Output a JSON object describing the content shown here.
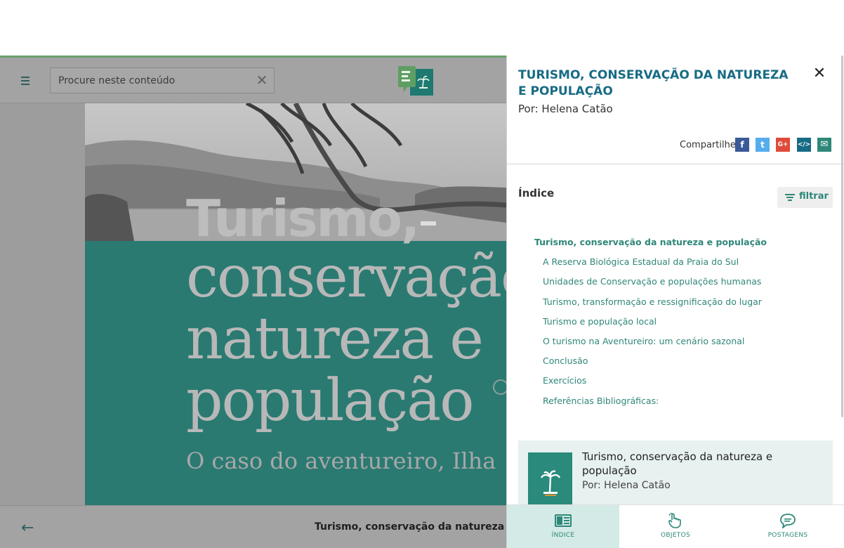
{
  "reader": {
    "search": {
      "placeholder": "Procure neste conteúdo",
      "clear": "✕"
    },
    "cover": {
      "title_line1": "Turismo,",
      "title_line2": "conservação da",
      "title_line3": "natureza e",
      "title_line4": "população",
      "subtitle": "O caso do aventureiro, Ilha"
    },
    "back_glyph": "←",
    "bottom_title": "Turismo, conservação da natureza e população"
  },
  "drawer": {
    "title": "TURISMO, CONSERVAÇÃO DA NATUREZA E POPULAÇÃO",
    "author": "Por: Helena Catão",
    "close": "✕",
    "share_label": "Compartilhe:",
    "share": [
      {
        "name": "facebook-icon",
        "glyph": "f",
        "color": "#3b5998"
      },
      {
        "name": "twitter-icon",
        "glyph": "t",
        "color": "#55acee"
      },
      {
        "name": "googleplus-icon",
        "glyph": "G+",
        "color": "#dd4b39"
      },
      {
        "name": "embed-icon",
        "glyph": "</>",
        "color": "#176b84"
      },
      {
        "name": "email-icon",
        "glyph": "✉",
        "color": "#2f8779"
      }
    ],
    "index_label": "Índice",
    "filter_label": "filtrar",
    "toc": [
      "Turismo, conservação da natureza e população",
      "A Reserva Biológica Estadual da Praia do Sul",
      "Unidades de Conservação e populações humanas",
      "Turismo, transformação e ressignificação do lugar",
      "Turismo e população local",
      "O turismo na Aventureiro: um cenário sazonal",
      "Conclusão",
      "Exercícios",
      "Referências Bibliográficas:"
    ],
    "card": {
      "title": "Turismo, conservação da natureza e população",
      "author": "Por: Helena Catão"
    },
    "tabs": [
      {
        "label": "ÍNDICE",
        "icon": "book-icon"
      },
      {
        "label": "OBJETOS",
        "icon": "touch-icon"
      },
      {
        "label": "POSTAGENS",
        "icon": "chat-icon"
      }
    ]
  },
  "colors": {
    "accent": "#2f8779",
    "title": "#176b84",
    "cover": "#2a7a72"
  }
}
